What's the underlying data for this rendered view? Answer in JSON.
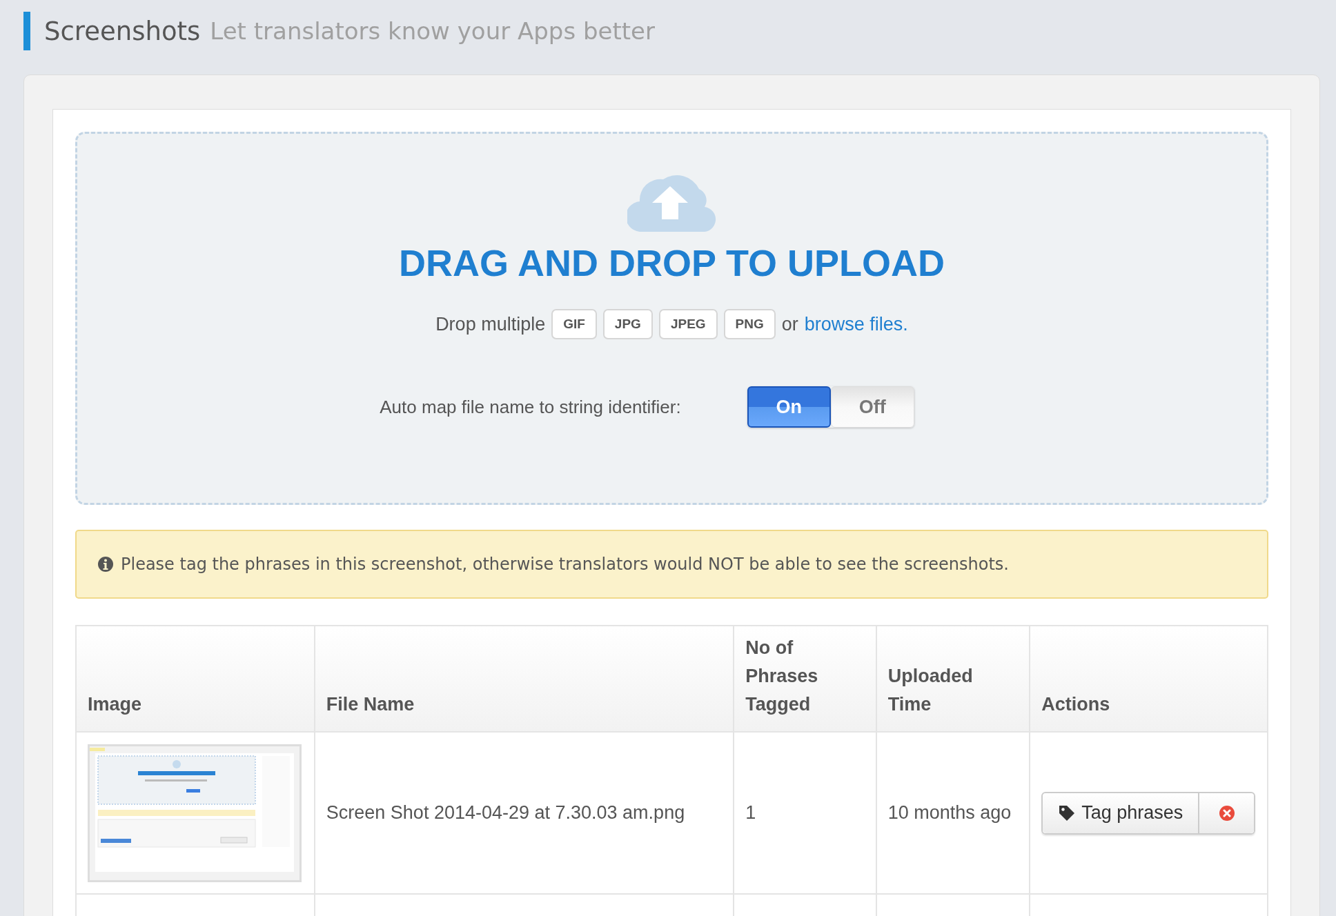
{
  "page_header": {
    "title": "Screenshots",
    "subtitle": "Let translators know your Apps better"
  },
  "upload": {
    "heading": "DRAG AND DROP TO UPLOAD",
    "drop_prefix": "Drop multiple",
    "file_types": [
      "GIF",
      "JPG",
      "JPEG",
      "PNG"
    ],
    "or_text": "or",
    "browse_link": "browse files.",
    "auto_map_label": "Auto map file name to string identifier:",
    "toggle": [
      {
        "label": "On",
        "selected": true
      },
      {
        "label": "Off",
        "selected": false
      }
    ]
  },
  "alert": {
    "text": "Please tag the phrases in this screenshot, otherwise translators would NOT be able to see the screenshots."
  },
  "table": {
    "columns": [
      "Image",
      "File Name",
      "No of Phrases Tagged",
      "Uploaded Time",
      "Actions"
    ],
    "rows": [
      {
        "file_name": "Screen Shot 2014-04-29 at 7.30.03 am.png",
        "phrases_tagged": "1",
        "uploaded_time": "10 months ago",
        "action": "Tag phrases"
      }
    ]
  }
}
